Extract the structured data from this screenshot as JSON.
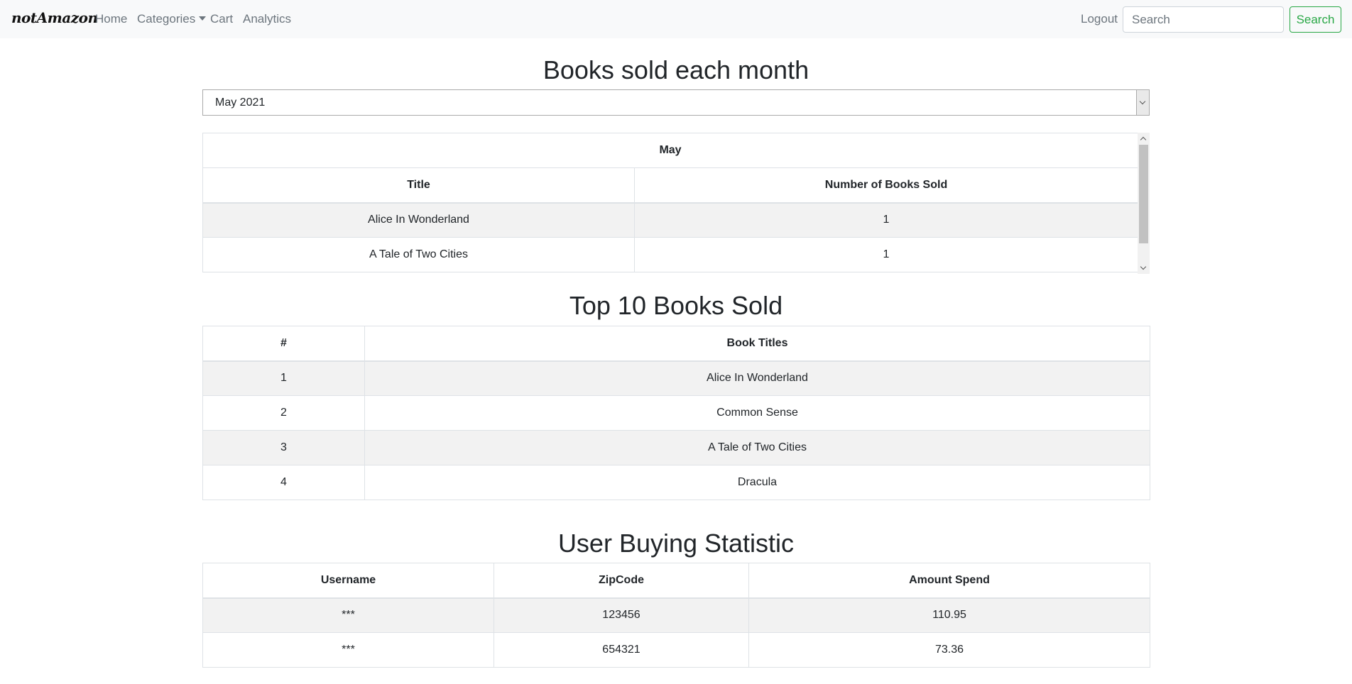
{
  "navbar": {
    "brand": "notAmazon",
    "links": {
      "home": "Home",
      "categories": "Categories",
      "cart": "Cart",
      "analytics": "Analytics",
      "logout": "Logout"
    },
    "search_placeholder": "Search",
    "search_button": "Search",
    "accent_color": "#28a745"
  },
  "monthly": {
    "title": "Books sold each month",
    "selected_month": "May 2021",
    "table_caption": "May",
    "columns": [
      "Title",
      "Number of Books Sold"
    ],
    "rows": [
      {
        "title": "Alice In Wonderland",
        "count": "1"
      },
      {
        "title": "A Tale of Two Cities",
        "count": "1"
      }
    ]
  },
  "top_books": {
    "title": "Top 10 Books Sold",
    "columns": [
      "#",
      "Book Titles"
    ],
    "rows": [
      {
        "rank": "1",
        "title": "Alice In Wonderland"
      },
      {
        "rank": "2",
        "title": "Common Sense"
      },
      {
        "rank": "3",
        "title": "A Tale of Two Cities"
      },
      {
        "rank": "4",
        "title": "Dracula"
      }
    ]
  },
  "user_stats": {
    "title": "User Buying Statistic",
    "columns": [
      "Username",
      "ZipCode",
      "Amount Spend"
    ],
    "rows": [
      {
        "username": "***",
        "zipcode": "123456",
        "amount": "110.95"
      },
      {
        "username": "***",
        "zipcode": "654321",
        "amount": "73.36"
      }
    ]
  }
}
